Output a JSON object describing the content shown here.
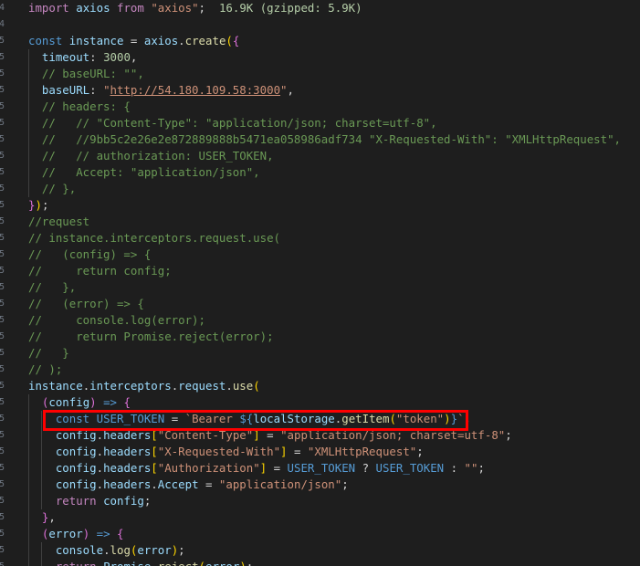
{
  "editor": {
    "import_size": "16.9K (gzipped: 5.9K)",
    "highlight_color": "#ff0000"
  },
  "line_numbers": [
    "4",
    "4",
    "5",
    "5",
    "5",
    "5",
    "5",
    "5",
    "5",
    "5",
    "5",
    "5",
    "5",
    "5",
    "5",
    "5",
    "5",
    "5",
    "5",
    "5",
    "5",
    "5",
    "5",
    "5",
    "5",
    "5",
    "5",
    "5",
    "5",
    "5",
    "5",
    "5",
    "5",
    "5",
    "5"
  ],
  "lines": [
    [
      {
        "t": "import",
        "c": "kwc"
      },
      {
        "t": " ",
        "c": "op"
      },
      {
        "t": "axios",
        "c": "var"
      },
      {
        "t": " ",
        "c": "op"
      },
      {
        "t": "from",
        "c": "kwc"
      },
      {
        "t": " ",
        "c": "op"
      },
      {
        "t": "\"axios\"",
        "c": "str"
      },
      {
        "t": ";  ",
        "c": "op"
      },
      {
        "t": "16.9K (gzipped: 5.9K)",
        "c": "size"
      }
    ],
    [],
    [
      {
        "t": "const",
        "c": "kw"
      },
      {
        "t": " ",
        "c": "op"
      },
      {
        "t": "instance",
        "c": "var"
      },
      {
        "t": " = ",
        "c": "op"
      },
      {
        "t": "axios",
        "c": "var"
      },
      {
        "t": ".",
        "c": "op"
      },
      {
        "t": "create",
        "c": "fn"
      },
      {
        "t": "(",
        "c": "br1"
      },
      {
        "t": "{",
        "c": "br2"
      }
    ],
    [
      {
        "t": "  timeout",
        "c": "var"
      },
      {
        "t": ": ",
        "c": "op"
      },
      {
        "t": "3000",
        "c": "num"
      },
      {
        "t": ",",
        "c": "op"
      }
    ],
    [
      {
        "t": "  // baseURL: \"\",",
        "c": "cmt"
      }
    ],
    [
      {
        "t": "  baseURL",
        "c": "var"
      },
      {
        "t": ": ",
        "c": "op"
      },
      {
        "t": "\"",
        "c": "str"
      },
      {
        "t": "http://54.180.109.58:3000",
        "c": "url"
      },
      {
        "t": "\"",
        "c": "str"
      },
      {
        "t": ",",
        "c": "op"
      }
    ],
    [
      {
        "t": "  // headers: {",
        "c": "cmt"
      }
    ],
    [
      {
        "t": "  //   // \"Content-Type\": \"application/json; charset=utf-8\",",
        "c": "cmt"
      }
    ],
    [
      {
        "t": "  //   //9bb5c2e26e2e872889888b5471ea058986adf734 \"X-Requested-With\": \"XMLHttpRequest\",",
        "c": "cmt"
      }
    ],
    [
      {
        "t": "  //   // authorization: USER_TOKEN,",
        "c": "cmt"
      }
    ],
    [
      {
        "t": "  //   Accept: \"application/json\",",
        "c": "cmt"
      }
    ],
    [
      {
        "t": "  // },",
        "c": "cmt"
      }
    ],
    [
      {
        "t": "}",
        "c": "br2"
      },
      {
        "t": ")",
        "c": "br1"
      },
      {
        "t": ";",
        "c": "op"
      }
    ],
    [
      {
        "t": "//request",
        "c": "cmt"
      }
    ],
    [
      {
        "t": "// instance.interceptors.request.use(",
        "c": "cmt"
      }
    ],
    [
      {
        "t": "//   (config) => {",
        "c": "cmt"
      }
    ],
    [
      {
        "t": "//     return config;",
        "c": "cmt"
      }
    ],
    [
      {
        "t": "//   },",
        "c": "cmt"
      }
    ],
    [
      {
        "t": "//   (error) => {",
        "c": "cmt"
      }
    ],
    [
      {
        "t": "//     console.log(error);",
        "c": "cmt"
      }
    ],
    [
      {
        "t": "//     return Promise.reject(error);",
        "c": "cmt"
      }
    ],
    [
      {
        "t": "//   }",
        "c": "cmt"
      }
    ],
    [
      {
        "t": "// );",
        "c": "cmt"
      }
    ],
    [
      {
        "t": "instance",
        "c": "var"
      },
      {
        "t": ".",
        "c": "op"
      },
      {
        "t": "interceptors",
        "c": "var"
      },
      {
        "t": ".",
        "c": "op"
      },
      {
        "t": "request",
        "c": "var"
      },
      {
        "t": ".",
        "c": "op"
      },
      {
        "t": "use",
        "c": "fn"
      },
      {
        "t": "(",
        "c": "br1"
      }
    ],
    [
      {
        "t": "  ",
        "c": "op"
      },
      {
        "t": "(",
        "c": "br2"
      },
      {
        "t": "config",
        "c": "var"
      },
      {
        "t": ")",
        "c": "br2"
      },
      {
        "t": " ",
        "c": "op"
      },
      {
        "t": "=>",
        "c": "kw"
      },
      {
        "t": " ",
        "c": "op"
      },
      {
        "t": "{",
        "c": "br2"
      }
    ],
    [
      {
        "t": "    ",
        "c": "op"
      },
      {
        "t": "const",
        "c": "kw"
      },
      {
        "t": " ",
        "c": "op"
      },
      {
        "t": "USER_TOKEN",
        "c": "kw"
      },
      {
        "t": " = ",
        "c": "op"
      },
      {
        "t": "`Bearer ",
        "c": "str"
      },
      {
        "t": "${",
        "c": "kw"
      },
      {
        "t": "localStorage",
        "c": "var"
      },
      {
        "t": ".",
        "c": "op"
      },
      {
        "t": "getItem",
        "c": "fn"
      },
      {
        "t": "(",
        "c": "br1"
      },
      {
        "t": "\"token\"",
        "c": "str"
      },
      {
        "t": ")",
        "c": "br1"
      },
      {
        "t": "}",
        "c": "kw"
      },
      {
        "t": "`",
        "c": "str"
      },
      {
        "t": ";",
        "c": "op"
      }
    ],
    [
      {
        "t": "    config",
        "c": "var"
      },
      {
        "t": ".",
        "c": "op"
      },
      {
        "t": "headers",
        "c": "var"
      },
      {
        "t": "[",
        "c": "br1"
      },
      {
        "t": "\"Content-Type\"",
        "c": "str"
      },
      {
        "t": "]",
        "c": "br1"
      },
      {
        "t": " = ",
        "c": "op"
      },
      {
        "t": "\"application/json; charset=utf-8\"",
        "c": "str"
      },
      {
        "t": ";",
        "c": "op"
      }
    ],
    [
      {
        "t": "    config",
        "c": "var"
      },
      {
        "t": ".",
        "c": "op"
      },
      {
        "t": "headers",
        "c": "var"
      },
      {
        "t": "[",
        "c": "br1"
      },
      {
        "t": "\"X-Requested-With\"",
        "c": "str"
      },
      {
        "t": "]",
        "c": "br1"
      },
      {
        "t": " = ",
        "c": "op"
      },
      {
        "t": "\"XMLHttpRequest\"",
        "c": "str"
      },
      {
        "t": ";",
        "c": "op"
      }
    ],
    [
      {
        "t": "    config",
        "c": "var"
      },
      {
        "t": ".",
        "c": "op"
      },
      {
        "t": "headers",
        "c": "var"
      },
      {
        "t": "[",
        "c": "br1"
      },
      {
        "t": "\"Authorization\"",
        "c": "str"
      },
      {
        "t": "]",
        "c": "br1"
      },
      {
        "t": " = ",
        "c": "op"
      },
      {
        "t": "USER_TOKEN",
        "c": "kw"
      },
      {
        "t": " ? ",
        "c": "op"
      },
      {
        "t": "USER_TOKEN",
        "c": "kw"
      },
      {
        "t": " : ",
        "c": "op"
      },
      {
        "t": "\"\"",
        "c": "str"
      },
      {
        "t": ";",
        "c": "op"
      }
    ],
    [
      {
        "t": "    config",
        "c": "var"
      },
      {
        "t": ".",
        "c": "op"
      },
      {
        "t": "headers",
        "c": "var"
      },
      {
        "t": ".",
        "c": "op"
      },
      {
        "t": "Accept",
        "c": "var"
      },
      {
        "t": " = ",
        "c": "op"
      },
      {
        "t": "\"application/json\"",
        "c": "str"
      },
      {
        "t": ";",
        "c": "op"
      }
    ],
    [
      {
        "t": "    ",
        "c": "op"
      },
      {
        "t": "return",
        "c": "kwc"
      },
      {
        "t": " ",
        "c": "op"
      },
      {
        "t": "config",
        "c": "var"
      },
      {
        "t": ";",
        "c": "op"
      }
    ],
    [
      {
        "t": "  ",
        "c": "op"
      },
      {
        "t": "}",
        "c": "br2"
      },
      {
        "t": ",",
        "c": "op"
      }
    ],
    [
      {
        "t": "  ",
        "c": "op"
      },
      {
        "t": "(",
        "c": "br2"
      },
      {
        "t": "error",
        "c": "var"
      },
      {
        "t": ")",
        "c": "br2"
      },
      {
        "t": " ",
        "c": "op"
      },
      {
        "t": "=>",
        "c": "kw"
      },
      {
        "t": " ",
        "c": "op"
      },
      {
        "t": "{",
        "c": "br2"
      }
    ],
    [
      {
        "t": "    console",
        "c": "var"
      },
      {
        "t": ".",
        "c": "op"
      },
      {
        "t": "log",
        "c": "fn"
      },
      {
        "t": "(",
        "c": "br1"
      },
      {
        "t": "error",
        "c": "var"
      },
      {
        "t": ")",
        "c": "br1"
      },
      {
        "t": ";",
        "c": "op"
      }
    ],
    [
      {
        "t": "    ",
        "c": "op"
      },
      {
        "t": "return",
        "c": "kwc"
      },
      {
        "t": " ",
        "c": "op"
      },
      {
        "t": "Promise",
        "c": "var"
      },
      {
        "t": ".",
        "c": "op"
      },
      {
        "t": "reject",
        "c": "fn"
      },
      {
        "t": "(",
        "c": "br1"
      },
      {
        "t": "error",
        "c": "var"
      },
      {
        "t": ")",
        "c": "br1"
      },
      {
        "t": ";",
        "c": "op"
      }
    ]
  ]
}
